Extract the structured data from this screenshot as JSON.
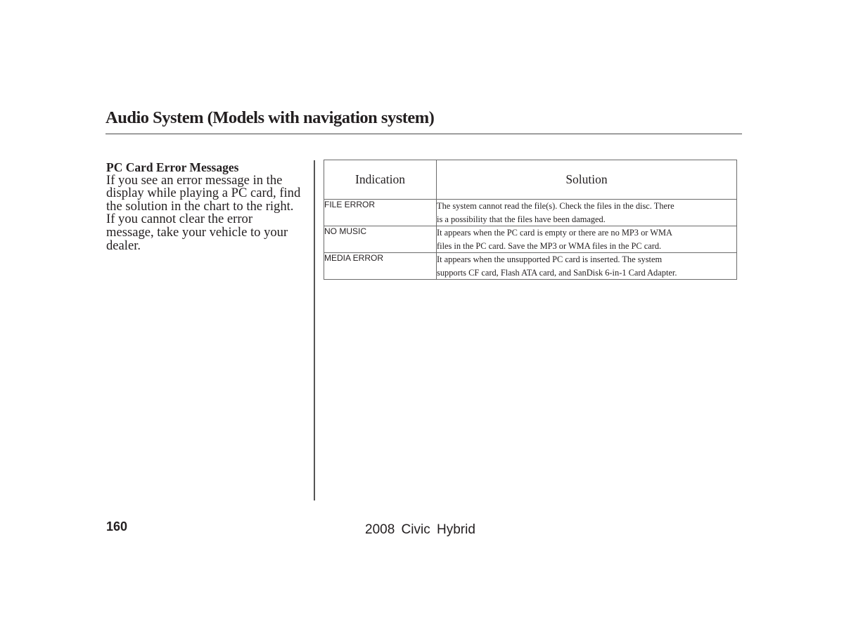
{
  "page": {
    "title": "Audio System (Models with navigation system)",
    "section_heading": "PC Card Error Messages",
    "body_text": "If you see an error message in the\ndisplay while playing a PC card, find\nthe solution in the chart to the right.\nIf you cannot clear the error\nmessage, take your vehicle to your\ndealer.",
    "page_number": "160",
    "footer_title": "2008  Civic  Hybrid"
  },
  "table": {
    "headers": [
      "Indication",
      "Solution"
    ],
    "rows": [
      {
        "indication": "FILE ERROR",
        "solution": "The system cannot read the file(s). Check the files in the disc. There\nis a possibility that the files have been damaged."
      },
      {
        "indication": "NO MUSIC",
        "solution": "It appears when the PC card is empty or there are no MP3 or WMA\nfiles in the PC card. Save the MP3 or WMA files in the PC card."
      },
      {
        "indication": "MEDIA ERROR",
        "solution": "It appears when the unsupported PC card is inserted. The system\nsupports CF card, Flash ATA card, and SanDisk 6-in-1 Card Adapter."
      }
    ]
  }
}
